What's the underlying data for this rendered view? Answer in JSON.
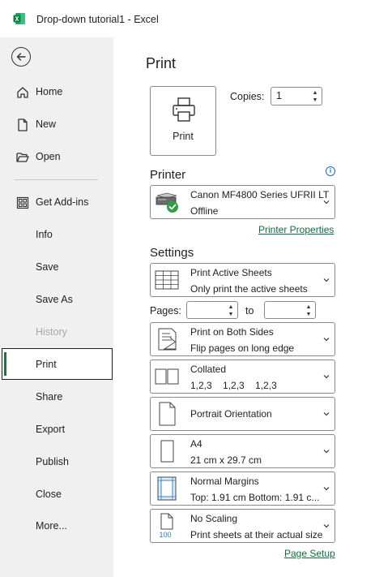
{
  "window": {
    "title": "Drop-down tutorial1  -  Excel",
    "app_icon": "excel-logo-icon",
    "accent_color": "#217346"
  },
  "nav": {
    "back_icon": "back-arrow-icon",
    "items": [
      {
        "label": "Home",
        "icon": "home-icon"
      },
      {
        "label": "New",
        "icon": "new-document-icon"
      },
      {
        "label": "Open",
        "icon": "folder-open-icon"
      },
      {
        "label": "Get Add-ins",
        "icon": "add-ins-grid-icon"
      },
      {
        "label": "Info"
      },
      {
        "label": "Save"
      },
      {
        "label": "Save As"
      },
      {
        "label": "History",
        "state": "disabled"
      },
      {
        "label": "Print",
        "state": "selected"
      },
      {
        "label": "Share"
      },
      {
        "label": "Export"
      },
      {
        "label": "Publish"
      },
      {
        "label": "Close"
      },
      {
        "label": "More..."
      }
    ]
  },
  "print": {
    "title": "Print",
    "print_button_label": "Print",
    "copies_label": "Copies:",
    "copies_value": "1",
    "printer_heading": "Printer",
    "printer": {
      "name": "Canon MF4800 Series UFRII LT",
      "status": "Offline",
      "icon": "printer-ready-icon"
    },
    "printer_properties_link": "Printer Properties",
    "settings_heading": "Settings",
    "pages_label": "Pages:",
    "to_label": "to",
    "pages_from": "",
    "pages_to": "",
    "settings": {
      "sheets": {
        "main": "Print Active Sheets",
        "sub": "Only print the active sheets",
        "icon": "sheets-grid-icon"
      },
      "sides": {
        "main": "Print on Both Sides",
        "sub": "Flip pages on long edge",
        "icon": "duplex-page-icon"
      },
      "collate": {
        "main": "Collated",
        "sub": "1,2,3    1,2,3    1,2,3",
        "icon": "collated-pages-icon"
      },
      "orientation": {
        "main": "Portrait Orientation",
        "icon": "portrait-page-icon"
      },
      "paper": {
        "main": "A4",
        "sub": "21 cm x 29.7 cm",
        "icon": "paper-size-icon"
      },
      "margins": {
        "main": "Normal Margins",
        "sub": "Top: 1.91 cm Bottom: 1.91 c...",
        "icon": "margins-icon"
      },
      "scaling": {
        "main": "No Scaling",
        "sub": "Print sheets at their actual size",
        "icon": "scaling-100-icon",
        "icon_text": "100"
      }
    },
    "page_setup_link": "Page Setup"
  }
}
